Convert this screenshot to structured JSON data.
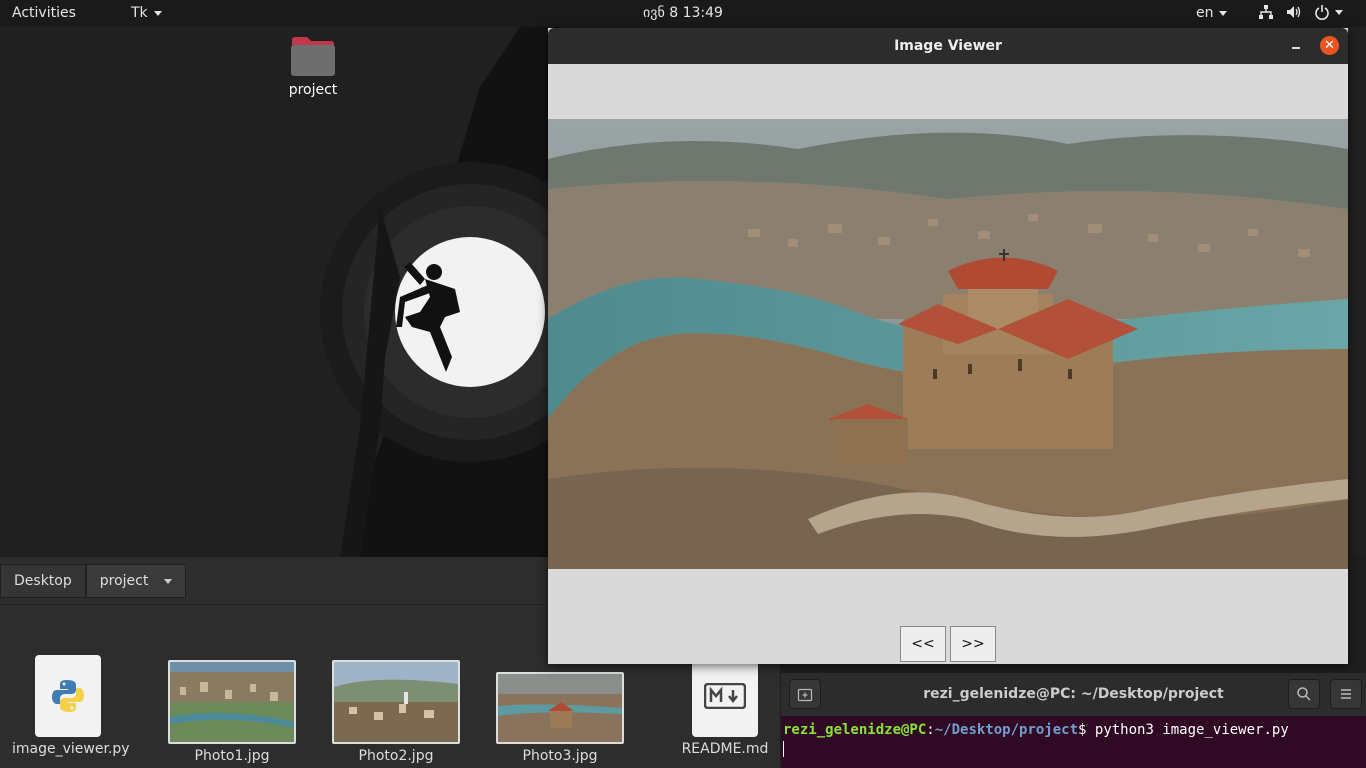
{
  "topbar": {
    "activities": "Activities",
    "app_menu": "Tk",
    "clock": "ივნ 8  13:49",
    "lang": "en",
    "tray_icons": [
      "network-icon",
      "volume-icon",
      "power-icon"
    ]
  },
  "desktop": {
    "folder_label": "project"
  },
  "file_manager": {
    "breadcrumbs": [
      "Desktop",
      "project"
    ],
    "files": [
      {
        "name": "image_viewer.py",
        "kind": "python"
      },
      {
        "name": "Photo1.jpg",
        "kind": "image"
      },
      {
        "name": "Photo2.jpg",
        "kind": "image"
      },
      {
        "name": "Photo3.jpg",
        "kind": "image"
      },
      {
        "name": "README.md",
        "kind": "markdown"
      }
    ]
  },
  "viewer": {
    "title": "Image Viewer",
    "close": "✕",
    "prev_label": "<<",
    "next_label": ">>"
  },
  "terminal": {
    "title": "rezi_gelenidze@PC: ~/Desktop/project",
    "user_host": "rezi_gelenidze@PC",
    "colon": ":",
    "path": "~/Desktop/project",
    "prompt_end": "$ ",
    "command": "python3 image_viewer.py"
  },
  "colors": {
    "accent": "#e95420",
    "terminal_bg": "#300a24",
    "prompt_user": "#8ae234",
    "prompt_path": "#729fcf"
  }
}
